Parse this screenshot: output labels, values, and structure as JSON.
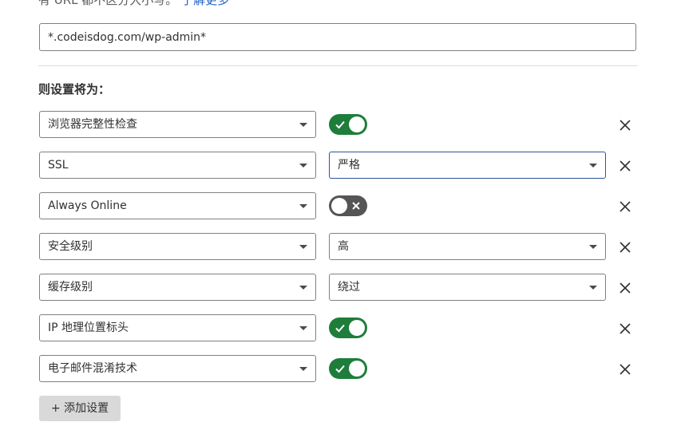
{
  "header_note": {
    "text": "有 URL 都不区分大小写。",
    "link": "了解更多"
  },
  "url_pattern": {
    "value": "*.codeisdog.com/wp-admin*"
  },
  "section_heading": "则设置将为：",
  "settings": [
    {
      "setting": "浏览器完整性检查",
      "control": "toggle",
      "state": "on"
    },
    {
      "setting": "SSL",
      "control": "select",
      "value": "严格"
    },
    {
      "setting": "Always Online",
      "control": "toggle",
      "state": "off"
    },
    {
      "setting": "安全级别",
      "control": "select",
      "value": "高"
    },
    {
      "setting": "缓存级别",
      "control": "select",
      "value": "绕过"
    },
    {
      "setting": "IP 地理位置标头",
      "control": "toggle",
      "state": "on"
    },
    {
      "setting": "电子邮件混淆技术",
      "control": "toggle",
      "state": "on"
    }
  ],
  "add_button": {
    "label": "+ 添加设置"
  },
  "colors": {
    "toggle_on": "#1e7d3a",
    "toggle_off": "#555555",
    "link": "#1a5fc4",
    "add_button_bg": "#d9d9d9"
  }
}
